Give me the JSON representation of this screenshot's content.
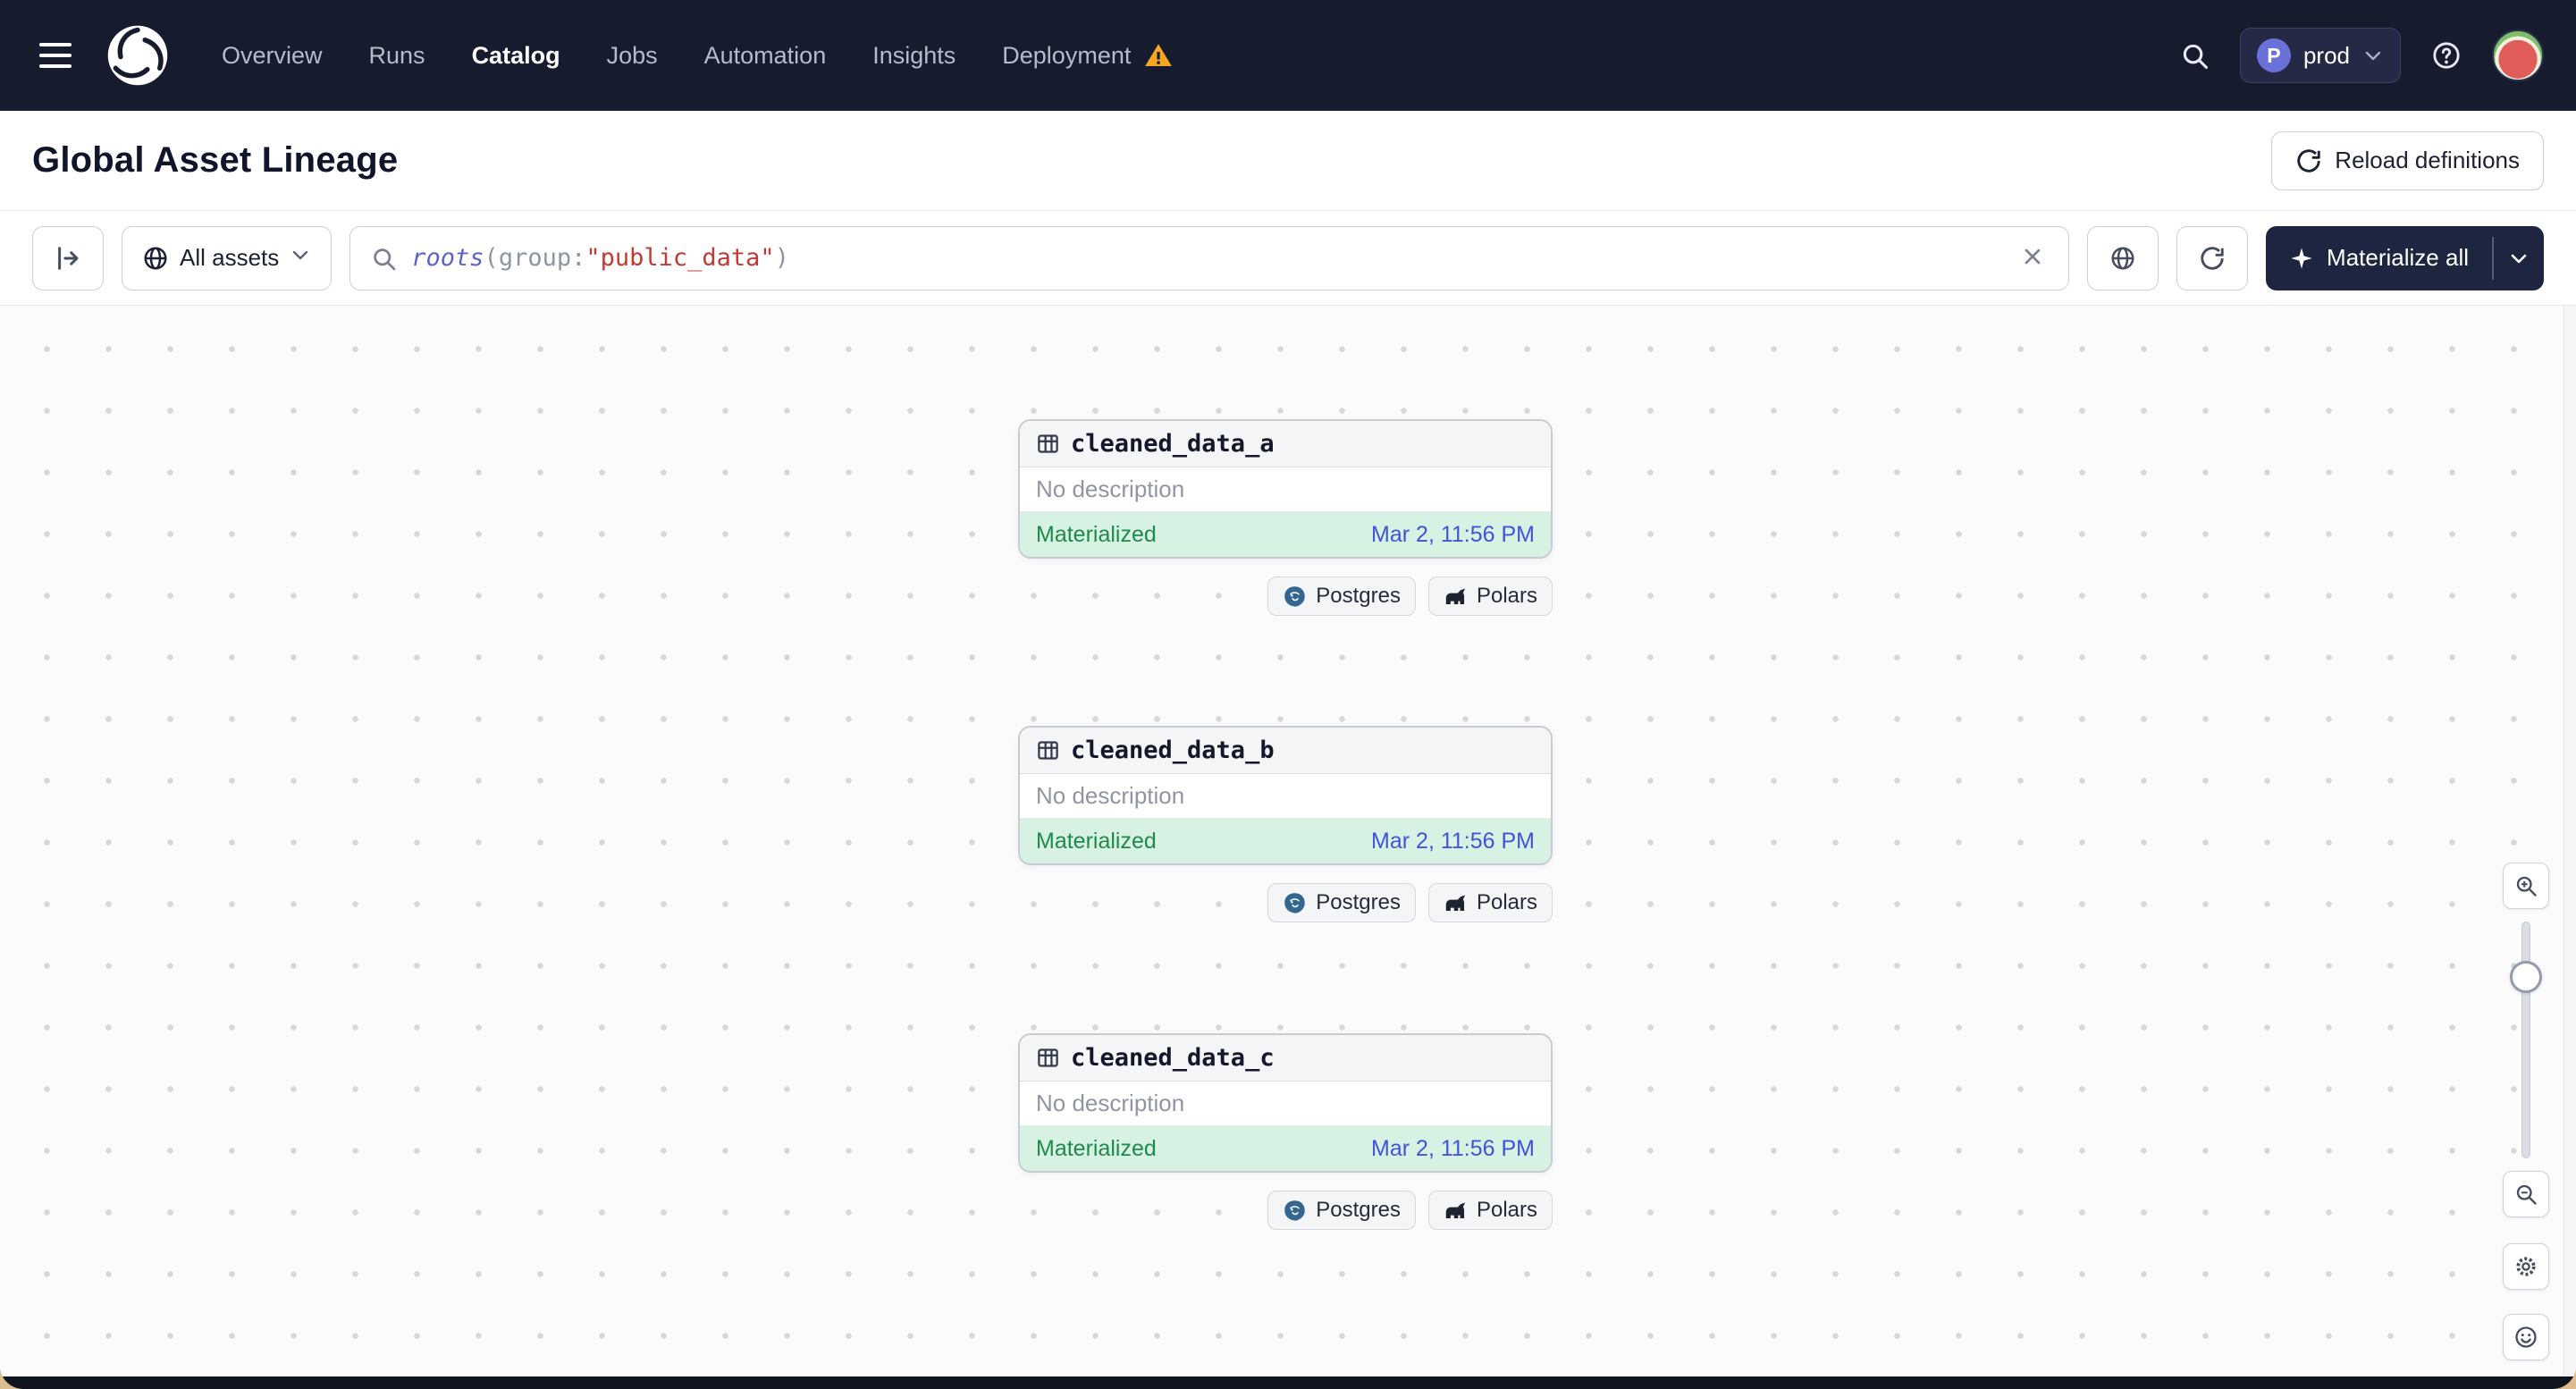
{
  "colors": {
    "navbar_bg": "#171b2e",
    "button_navy": "#1d2540",
    "materialized_bg": "#d7f2e2",
    "materialized_text": "#1f8a4b",
    "timestamp_blue": "#4353d9",
    "warning_orange": "#f5a623",
    "postgres_blue": "#336791",
    "grid_dot": "#d6d8de"
  },
  "navbar": {
    "links": [
      {
        "label": "Overview",
        "active": false
      },
      {
        "label": "Runs",
        "active": false
      },
      {
        "label": "Catalog",
        "active": true
      },
      {
        "label": "Jobs",
        "active": false
      },
      {
        "label": "Automation",
        "active": false
      },
      {
        "label": "Insights",
        "active": false
      },
      {
        "label": "Deployment",
        "active": false,
        "warning": true
      }
    ],
    "deployment_switcher": {
      "initial": "P",
      "name": "prod"
    }
  },
  "header": {
    "title": "Global Asset Lineage",
    "reload_button": "Reload definitions"
  },
  "toolbar": {
    "assets_filter_label": "All assets",
    "query": {
      "function": "roots",
      "punct_open": "(",
      "key": "group:",
      "value": "\"public_data\"",
      "punct_close": ")"
    },
    "materialize_button": "Materialize all"
  },
  "graph": {
    "nodes": [
      {
        "name": "cleaned_data_a",
        "description": "No description",
        "status": "Materialized",
        "timestamp": "Mar 2, 11:56 PM",
        "tags": [
          "Postgres",
          "Polars"
        ]
      },
      {
        "name": "cleaned_data_b",
        "description": "No description",
        "status": "Materialized",
        "timestamp": "Mar 2, 11:56 PM",
        "tags": [
          "Postgres",
          "Polars"
        ]
      },
      {
        "name": "cleaned_data_c",
        "description": "No description",
        "status": "Materialized",
        "timestamp": "Mar 2, 11:56 PM",
        "tags": [
          "Postgres",
          "Polars"
        ]
      }
    ]
  }
}
